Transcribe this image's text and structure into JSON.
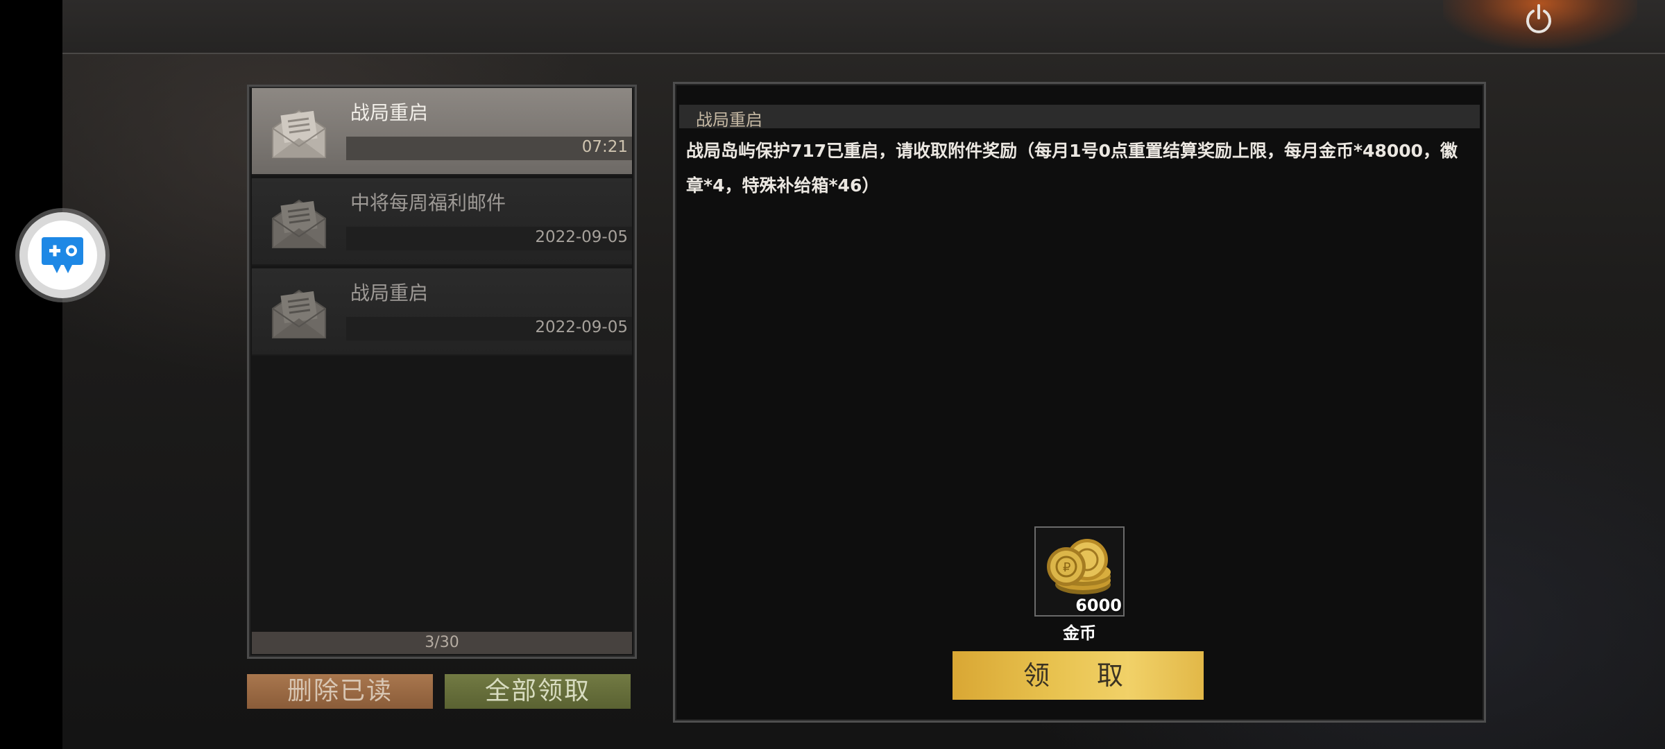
{
  "mail_list": {
    "items": [
      {
        "title": "战局重启",
        "date": "07:21",
        "selected": true
      },
      {
        "title": "中将每周福利邮件",
        "date": "2022-09-05",
        "selected": false
      },
      {
        "title": "战局重启",
        "date": "2022-09-05",
        "selected": false
      }
    ],
    "counter": "3/30"
  },
  "buttons": {
    "delete_read": "删除已读",
    "claim_all": "全部领取",
    "claim": "领 取"
  },
  "detail": {
    "title": "战局重启",
    "body": "战局岛屿保护717已重启，请收取附件奖励（每月1号0点重置结算奖励上限，每月金币*48000，徽章*4，特殊补给箱*46）",
    "attachment": {
      "name": "金币",
      "count": "6000",
      "icon": "gold-coins-icon"
    }
  },
  "icons": {
    "power": "power-icon",
    "floating": "gamepad-icon",
    "mail": "open-envelope-icon"
  },
  "colors": {
    "accent_gold": "#e8c24f",
    "delete_btn": "#a9774e",
    "claim_all_btn": "#727a43",
    "float_btn_blue": "#1e88e5"
  }
}
